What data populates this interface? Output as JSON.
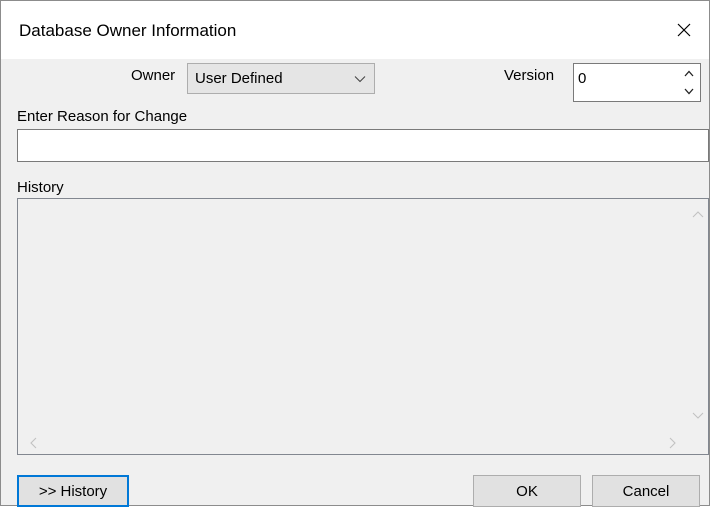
{
  "window": {
    "title": "Database Owner Information",
    "close_icon": "close-icon"
  },
  "owner": {
    "label": "Owner",
    "selected": "User Defined"
  },
  "version": {
    "label": "Version",
    "value": "0"
  },
  "reason": {
    "label": "Enter Reason for Change",
    "value": ""
  },
  "history": {
    "label": "History"
  },
  "buttons": {
    "history_toggle": ">> History",
    "ok": "OK",
    "cancel": "Cancel"
  },
  "colors": {
    "focus_border": "#0078d7",
    "dialog_bg": "#f0f0f0"
  }
}
